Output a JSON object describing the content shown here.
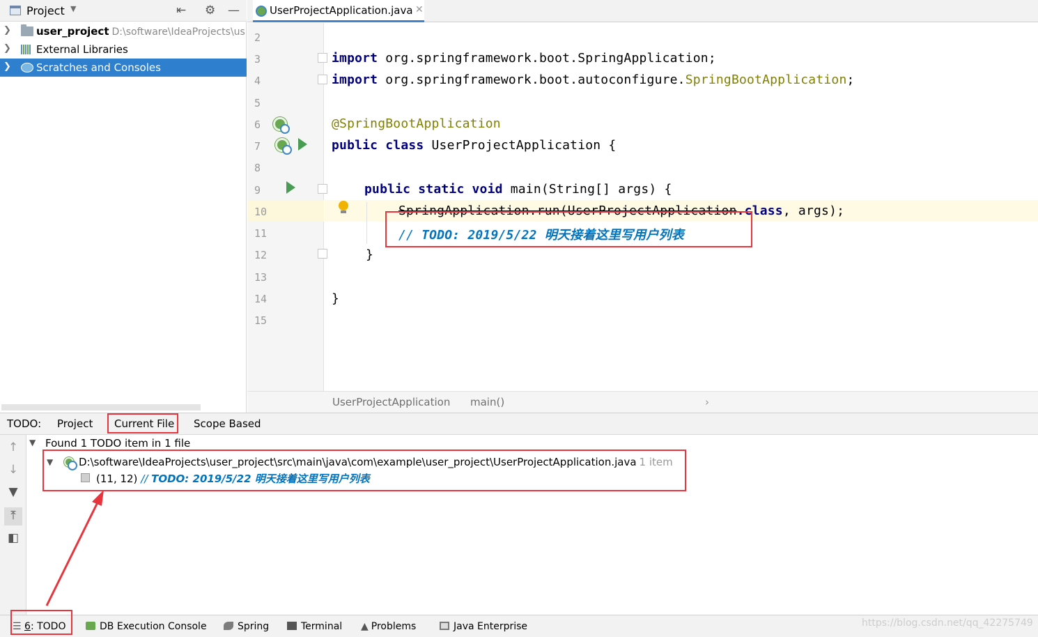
{
  "project_panel": {
    "title": "Project",
    "tree": [
      {
        "name": "user_project",
        "path": "D:\\software\\IdeaProjects\\us"
      },
      {
        "name": "External Libraries"
      },
      {
        "name": "Scratches and Consoles"
      }
    ]
  },
  "editor": {
    "tab_label": "UserProjectApplication.java",
    "line_numbers": [
      "2",
      "3",
      "4",
      "5",
      "6",
      "7",
      "8",
      "9",
      "10",
      "11",
      "12",
      "13",
      "14",
      "15"
    ],
    "code": {
      "l3_kw": "import",
      "l3_rest": " org.springframework.boot.SpringApplication;",
      "l4_kw": "import",
      "l4_pkg": " org.springframework.boot.autoconfigure.",
      "l4_cls": "SpringBootApplication",
      "l4_end": ";",
      "l6": "@SpringBootApplication",
      "l7_kw": "public class",
      "l7_rest": " UserProjectApplication {",
      "l9_kw": "public static void",
      "l9_rest": " main(String[] args) {",
      "l10_strike": "SpringApplication.run(UserProjectApplication",
      "l10_kw": ".class",
      "l10_rest": ", args);",
      "l11_slash": "// ",
      "l11_todo": "TODO: 2019/5/22 明天接着这里写用户列表",
      "l12": "}",
      "l14": "}"
    },
    "breadcrumb": [
      "UserProjectApplication",
      "main()"
    ]
  },
  "todo_panel": {
    "label": "TODO:",
    "tabs": [
      "Project",
      "Current File",
      "Scope Based"
    ],
    "summary": "Found 1 TODO item in 1 file",
    "file_path": "D:\\software\\IdeaProjects\\user_project\\src\\main\\java\\com\\example\\user_project\\UserProjectApplication.java",
    "file_count": "1 item",
    "item_location": "(11, 12)",
    "item_slash": "//",
    "item_text": "TODO: 2019/5/22 明天接着这里写用户列表"
  },
  "bottom_bar": {
    "todo_prefix": "6",
    "todo_label": ": TODO",
    "items": [
      "DB Execution Console",
      "Spring",
      "Terminal",
      "Problems",
      "Java Enterprise"
    ]
  },
  "watermark": "https://blog.csdn.net/qq_42275749",
  "colors": {
    "selection": "#2f7fcf",
    "keyword": "#000080",
    "annotation": "#808000",
    "todo": "#0073bf",
    "highlight_box": "#e8353d"
  }
}
